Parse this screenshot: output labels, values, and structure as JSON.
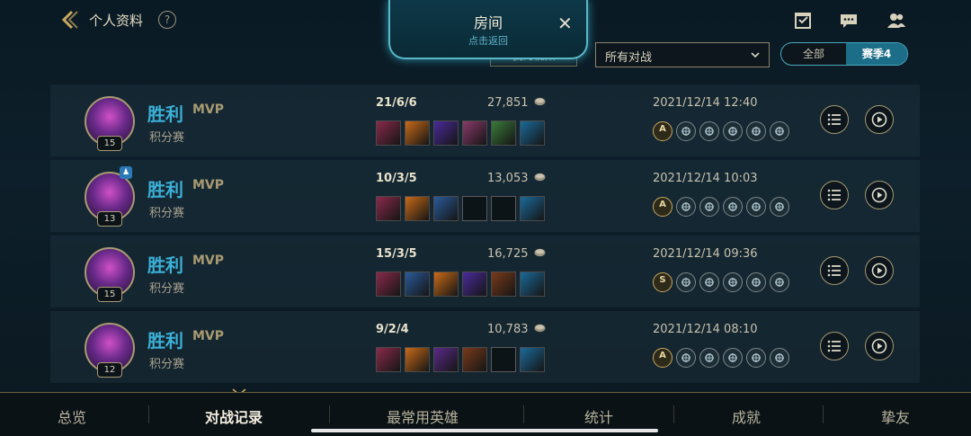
{
  "header": {
    "title": "个人资料",
    "help": "?"
  },
  "room": {
    "title": "房间",
    "subtitle": "点击返回",
    "close": "✕"
  },
  "toolbar": {
    "my_video": "我的视频",
    "filter_value": "所有对战",
    "seg_all": "全部",
    "seg_season": "赛季4"
  },
  "matches": [
    {
      "level": "15",
      "result": "胜利",
      "mvp": "MVP",
      "mode": "积分赛",
      "kda": "21/6/6",
      "gold": "27,851",
      "date": "2021/12/14 12:40",
      "first_rune": "A",
      "items": [
        "#8a2a4a",
        "#c86a18",
        "#4a2a9a",
        "#8a3a6a",
        "#3a7a3a",
        "#1a6a9a"
      ]
    },
    {
      "level": "13",
      "result": "胜利",
      "mvp": "MVP",
      "mode": "积分赛",
      "kda": "10/3/5",
      "gold": "13,053",
      "date": "2021/12/14 10:03",
      "first_rune": "A",
      "items": [
        "#8a2a4a",
        "#c86a18",
        "#2a5a9a",
        "empty",
        "empty",
        "#1a6a9a"
      ]
    },
    {
      "level": "15",
      "result": "胜利",
      "mvp": "MVP",
      "mode": "积分赛",
      "kda": "15/3/5",
      "gold": "16,725",
      "date": "2021/12/14 09:36",
      "first_rune": "S",
      "items": [
        "#8a2a4a",
        "#2a5a9a",
        "#c86a18",
        "#4a2a9a",
        "#7a3a1a",
        "#1a6a9a"
      ]
    },
    {
      "level": "12",
      "result": "胜利",
      "mvp": "MVP",
      "mode": "积分赛",
      "kda": "9/2/4",
      "gold": "10,783",
      "date": "2021/12/14 08:10",
      "first_rune": "A",
      "items": [
        "#8a2a4a",
        "#c86a18",
        "#5a2a8a",
        "#7a3a1a",
        "empty",
        "#1a6a9a"
      ]
    }
  ],
  "tabs": [
    {
      "label": "总览"
    },
    {
      "label": "对战记录"
    },
    {
      "label": "最常用英雄"
    },
    {
      "label": "统计"
    },
    {
      "label": "成就"
    },
    {
      "label": "挚友"
    }
  ],
  "colors": {
    "accent": "#3cb0d8",
    "gold": "#a89a72",
    "active_tab": "#f4eede"
  }
}
